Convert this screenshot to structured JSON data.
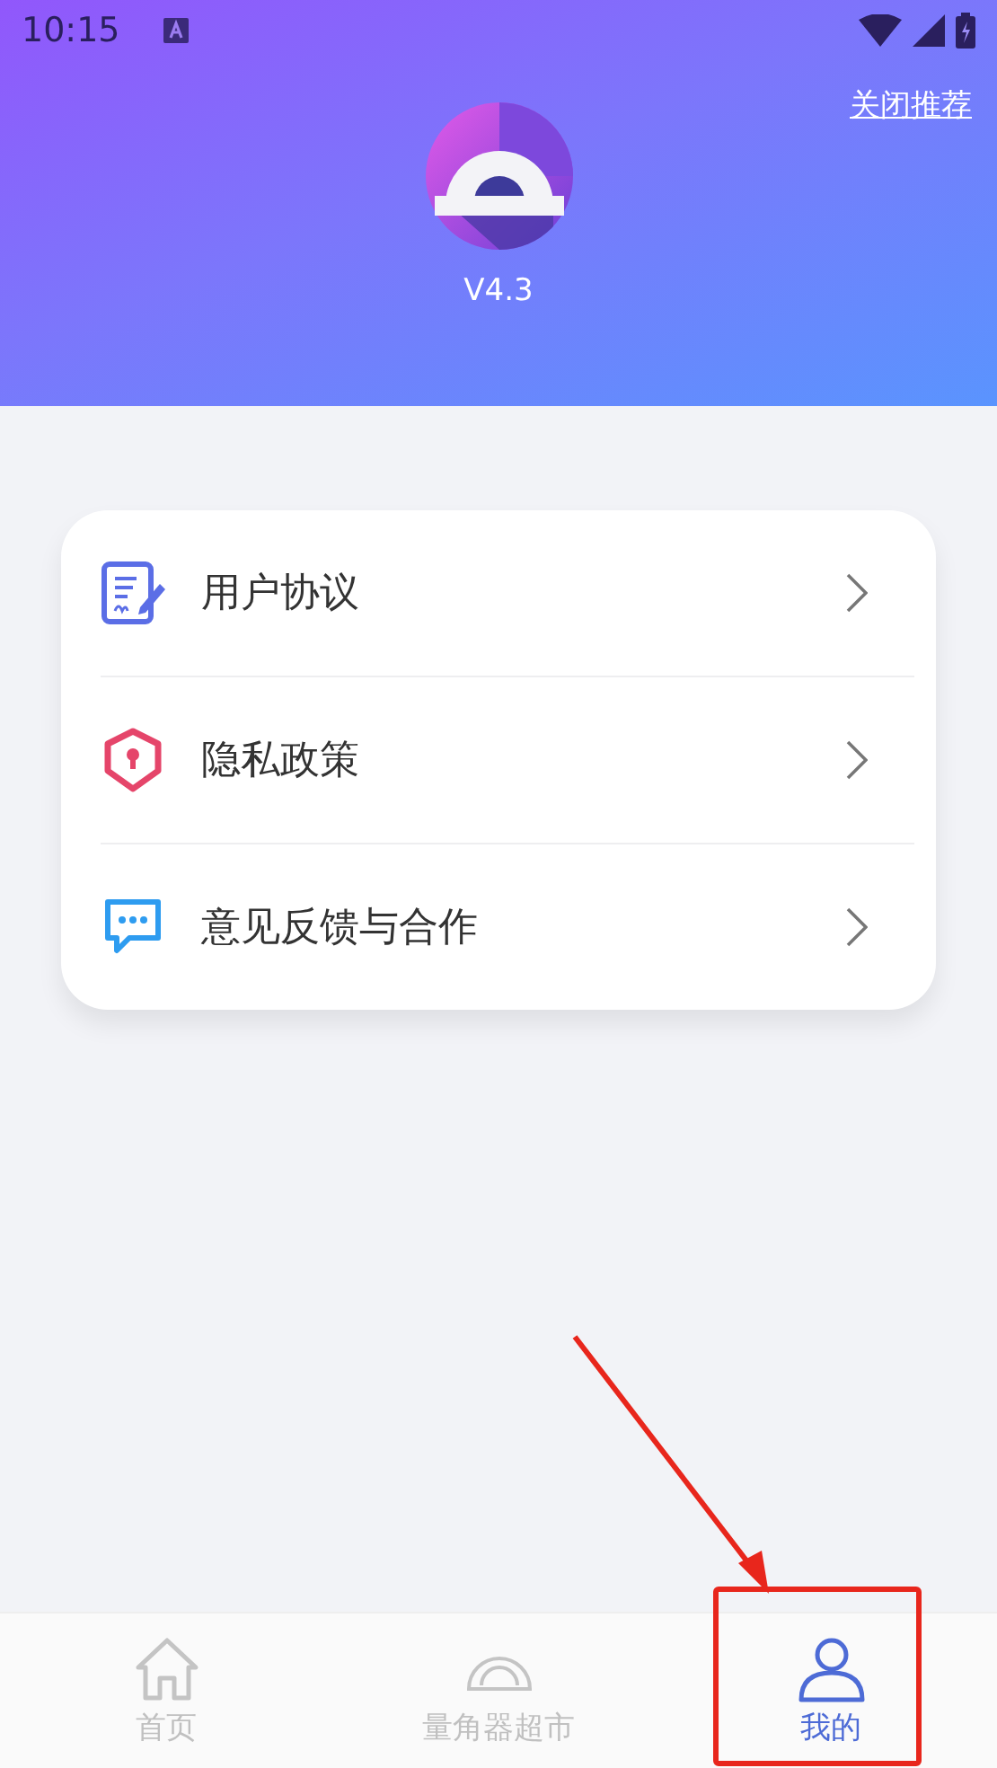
{
  "status_bar": {
    "time": "10:15"
  },
  "header": {
    "close_link": "关闭推荐",
    "version": "V4.3"
  },
  "menu": [
    {
      "kind": "agreement",
      "label": "用户协议"
    },
    {
      "kind": "privacy",
      "label": "隐私政策"
    },
    {
      "kind": "feedback",
      "label": "意见反馈与合作"
    }
  ],
  "tab_bar": [
    {
      "kind": "home",
      "label": "首页",
      "selected": false
    },
    {
      "kind": "protractor",
      "label": "量角器超市",
      "selected": false
    },
    {
      "kind": "profile",
      "label": "我的",
      "selected": true
    }
  ]
}
